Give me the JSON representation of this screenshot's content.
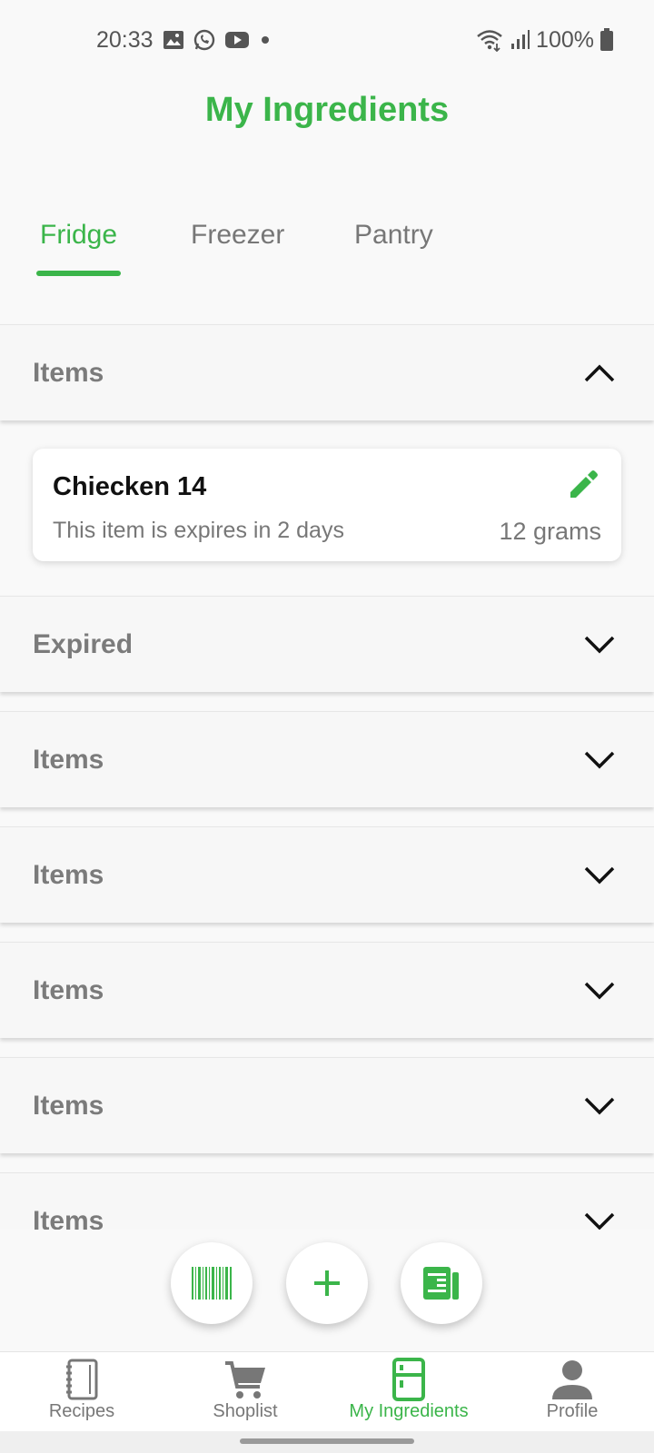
{
  "status_bar": {
    "time": "20:33",
    "battery": "100%",
    "icons": [
      "gallery-icon",
      "whatsapp-icon",
      "youtube-icon",
      "dot-icon",
      "wifi-icon",
      "signal-icon",
      "battery-icon"
    ]
  },
  "header": {
    "title": "My Ingredients"
  },
  "colors": {
    "accent": "#3bb54a",
    "muted": "#7b7b7b"
  },
  "tabs": [
    {
      "label": "Fridge",
      "active": true
    },
    {
      "label": "Freezer",
      "active": false
    },
    {
      "label": "Pantry",
      "active": false
    }
  ],
  "sections": [
    {
      "label": "Items",
      "expanded": true
    },
    {
      "label": "Expired",
      "expanded": false
    },
    {
      "label": "Items",
      "expanded": false
    },
    {
      "label": "Items",
      "expanded": false
    },
    {
      "label": "Items",
      "expanded": false
    },
    {
      "label": "Items",
      "expanded": false
    },
    {
      "label": "Items",
      "expanded": false
    }
  ],
  "items": [
    {
      "name": "Chiecken 14",
      "expiry": "This item is expires in 2 days",
      "quantity": "12 grams"
    }
  ],
  "fabs": [
    "barcode-scan-icon",
    "add-icon",
    "receipt-icon"
  ],
  "bottom_nav": [
    {
      "label": "Recipes",
      "icon": "notebook-icon",
      "active": false
    },
    {
      "label": "Shoplist",
      "icon": "cart-icon",
      "active": false
    },
    {
      "label": "My Ingredients",
      "icon": "fridge-icon",
      "active": true
    },
    {
      "label": "Profile",
      "icon": "person-icon",
      "active": false
    }
  ]
}
